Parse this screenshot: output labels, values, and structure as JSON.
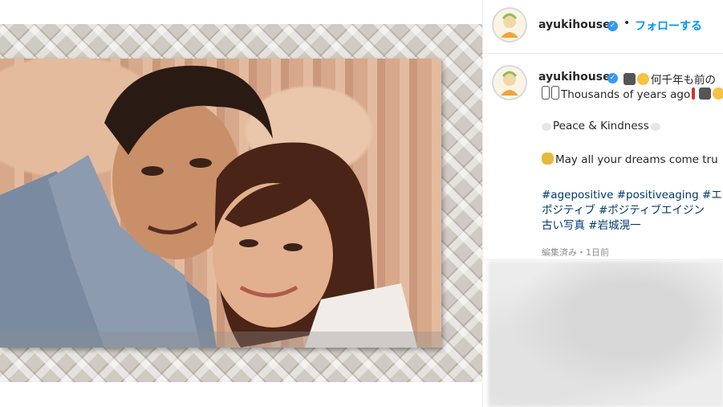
{
  "post": {
    "username": "ayukihouse",
    "separator": "•",
    "follow_label": "フォローする"
  },
  "caption": {
    "line1": "何千年も前の",
    "line2": "Thousands of years ago",
    "line3": "Peace & Kindness",
    "line4": "May all your dreams come tru",
    "line5": "#agepositive #positiveaging #エー",
    "line6": "ポジティブ #ポジティブエイジン",
    "line7": "古い写真 #岩城滉一",
    "meta": "編集済み・1日前"
  },
  "icons": {
    "verified": "verified-badge-icon",
    "camera": "camera-emoji-icon",
    "laugh": "laughing-emoji-icon",
    "dove": "dove-emoji-icon",
    "sparkle": "fairy-emoji-icon"
  },
  "colors": {
    "accent": "#0095f6",
    "hashtag": "#00376b",
    "verified": "#3897f0",
    "meta": "#8e8e8e"
  }
}
